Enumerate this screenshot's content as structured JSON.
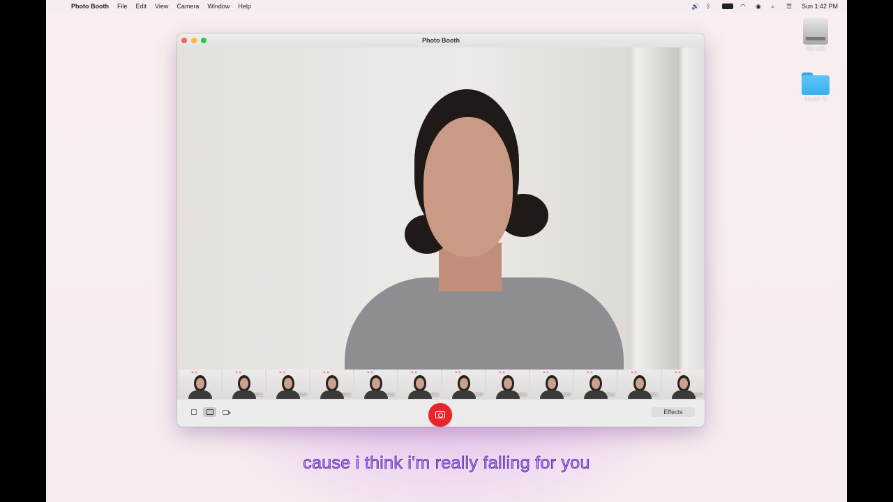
{
  "menubar": {
    "app_name": "Photo Booth",
    "items": [
      "File",
      "Edit",
      "View",
      "Camera",
      "Window",
      "Help"
    ],
    "clock": "Sun 1:42 PM",
    "status_icons": [
      "volume-icon",
      "bluetooth-icon",
      "battery-icon",
      "wifi-icon",
      "user-icon",
      "search-icon",
      "control-center-icon"
    ]
  },
  "desktop": {
    "icons": [
      {
        "label": "wild-wilde",
        "icon": "drive-icon"
      },
      {
        "label": "shy girl <3",
        "icon": "folder-icon"
      }
    ]
  },
  "window": {
    "title": "Photo Booth",
    "thumbnails": [
      {
        "duration": ""
      },
      {
        "duration": "00:1"
      },
      {
        "duration": "00:3"
      },
      {
        "duration": "00:1"
      },
      {
        "duration": "00:2"
      },
      {
        "duration": "00:1"
      },
      {
        "duration": "00:0"
      },
      {
        "duration": "00:1"
      },
      {
        "duration": "00:0"
      },
      {
        "duration": "00:4"
      },
      {
        "duration": "00:1"
      },
      {
        "duration": "00:5"
      }
    ],
    "effects_label": "Effects"
  },
  "caption": "cause i think i'm really falling for you",
  "colors": {
    "shutter": "#e8242a",
    "caption_fill": "#b58bf2",
    "caption_stroke": "#6a36b8"
  }
}
